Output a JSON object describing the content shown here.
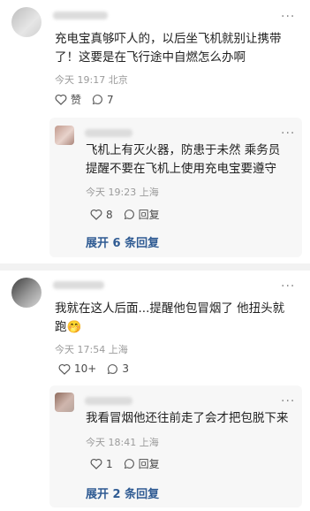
{
  "more_symbol": "···",
  "comments": [
    {
      "text_lines": [
        "充电宝真够吓人的，以后坐飞机就别让携带",
        "了！这要是在飞行途中自燃怎么办啊"
      ],
      "time": "今天 19:17",
      "location": "北京",
      "like_label": "赞",
      "comment_count": "7",
      "reply": {
        "text_lines": [
          "飞机上有灭火器，防患于未然 乘务员",
          "提醒不要在飞机上使用充电宝要遵守"
        ],
        "time": "今天 19:23",
        "location": "上海",
        "like_count": "8",
        "reply_label": "回复",
        "expand": "展开 6 条回复"
      }
    },
    {
      "text_lines": [
        "我就在这人后面...提醒他包冒烟了 他扭头就",
        "跑"
      ],
      "emoji": "🤭",
      "time": "今天 17:54",
      "location": "上海",
      "like_count": "10+",
      "comment_count": "3",
      "reply": {
        "text_lines": [
          "我看冒烟他还往前走了会才把包脱下来"
        ],
        "time": "今天 18:41",
        "location": "上海",
        "like_count": "1",
        "reply_label": "回复",
        "expand": "展开 2 条回复"
      }
    }
  ]
}
